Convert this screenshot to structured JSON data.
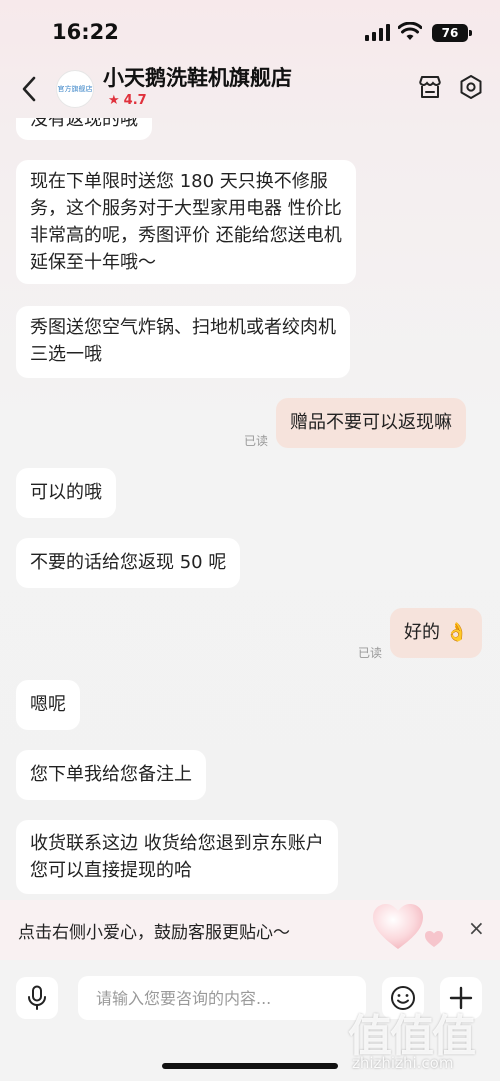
{
  "status_bar": {
    "time": "16:22",
    "battery": "76"
  },
  "header": {
    "shop_name": "小天鹅洗鞋机旗舰店",
    "avatar_text": "官方旗舰店",
    "rating": "4.7",
    "rating_icon": "star-icon"
  },
  "messages": [
    {
      "side": "in",
      "lines": [
        "没有返现的哦"
      ]
    },
    {
      "side": "in",
      "lines": [
        "现在下单限时送您 180 天只换不修服",
        "务，这个服务对于大型家用电器 性价比",
        "非常高的呢，秀图评价 还能给您送电机",
        "延保至十年哦～"
      ]
    },
    {
      "side": "in",
      "lines": [
        "秀图送您空气炸锅、扫地机或者绞肉机",
        "三选一哦"
      ]
    },
    {
      "side": "out",
      "lines": [
        "赠品不要可以返现嘛"
      ],
      "status": "已读"
    },
    {
      "side": "in",
      "lines": [
        "可以的哦"
      ]
    },
    {
      "side": "in",
      "lines": [
        "不要的话给您返现 50 呢"
      ]
    },
    {
      "side": "out",
      "lines": [
        "好的 👌"
      ],
      "status": "已读"
    },
    {
      "side": "in",
      "lines": [
        "嗯呢"
      ]
    },
    {
      "side": "in",
      "lines": [
        "您下单我给您备注上"
      ]
    },
    {
      "side": "in",
      "lines": [
        "收货联系这边  收货给您退到京东账户",
        "您可以直接提现的哈"
      ]
    }
  ],
  "notice": {
    "text": "点击右侧小爱心，鼓励客服更贴心～",
    "close": "×"
  },
  "input": {
    "placeholder": "请输入您要咨询的内容..."
  },
  "watermark": {
    "logo": "值值值",
    "url": "zhizhizhi.com"
  },
  "colors": {
    "incoming_bubble": "#ffffff",
    "outgoing_bubble": "#f6e3dc",
    "accent": "#e0313c"
  }
}
